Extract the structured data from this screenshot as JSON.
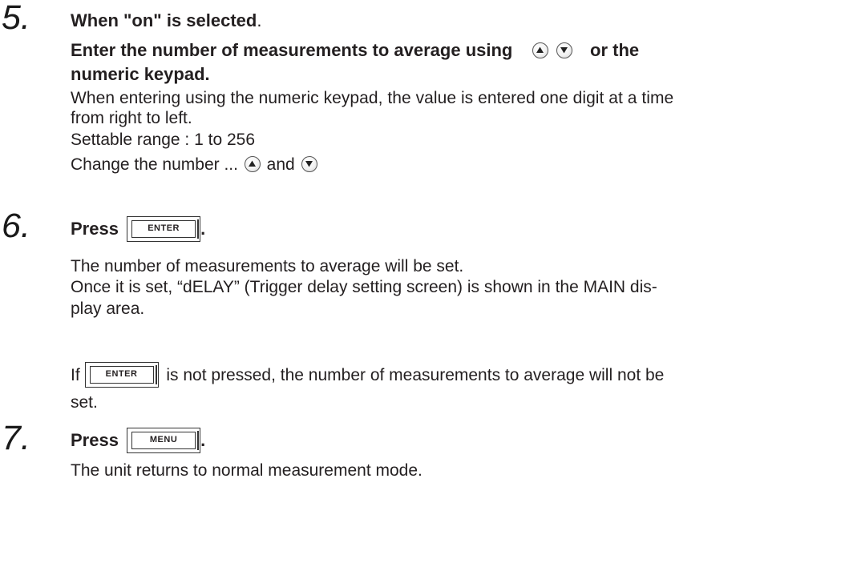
{
  "steps": {
    "s5": {
      "number": "5.",
      "title_bold": "When \"on\" is selected",
      "title_end": ".",
      "instruction_part1": "Enter the number of measurements to average using",
      "instruction_part2": "or the",
      "instruction_line2": "numeric keypad.",
      "body_line1": "When entering using the numeric keypad, the value is entered one digit at a time",
      "body_line2": "from right to left.",
      "range": "Settable range : 1 to 256",
      "change_text": "Change the number ...",
      "change_and": "and"
    },
    "s6": {
      "number": "6.",
      "press": "Press",
      "key": "ENTER",
      "period": ".",
      "body_line1": "The number of measurements to average will be set.",
      "body_line2": "Once it is set, “dELAY” (Trigger delay setting screen) is shown in the MAIN dis-",
      "body_line3": "play area.",
      "note_if": "If",
      "note_key": "ENTER",
      "note_rest": "is not pressed, the number of measurements to average will not be",
      "note_line2": "set."
    },
    "s7": {
      "number": "7.",
      "press": "Press",
      "key": "MENU",
      "period": ".",
      "body_line1": "The unit returns to normal measurement mode."
    }
  },
  "icons": {
    "up": "up-arrow-key-icon",
    "down": "down-arrow-key-icon"
  }
}
